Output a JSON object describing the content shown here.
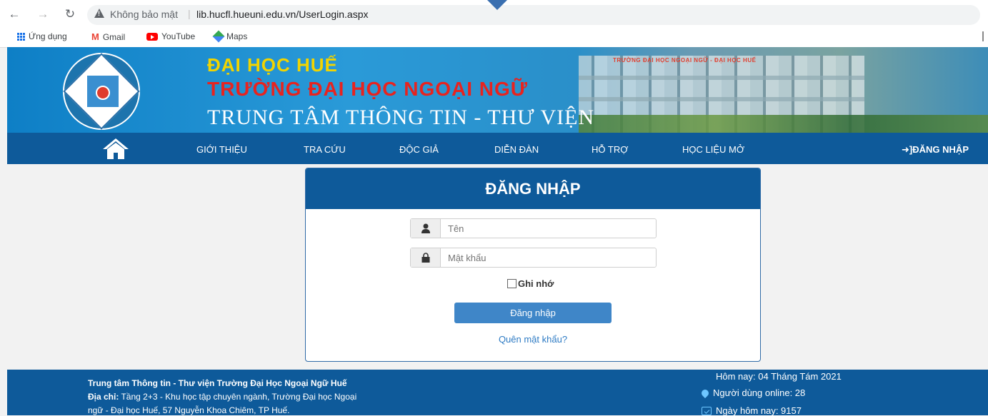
{
  "browser": {
    "security_label": "Không bảo mật",
    "separator": "|",
    "url": "lib.hucfl.hueuni.edu.vn/UserLogin.aspx",
    "bookmarks": [
      {
        "label": "Ứng dụng",
        "icon": "apps-icon"
      },
      {
        "label": "Gmail",
        "icon": "gmail-icon"
      },
      {
        "label": "YouTube",
        "icon": "youtube-icon"
      },
      {
        "label": "Maps",
        "icon": "maps-icon"
      }
    ]
  },
  "banner": {
    "line1": "ĐẠI HỌC HUẾ",
    "line2": "TRƯỜNG ĐẠI HỌC NGOẠI NGỮ",
    "line3": "TRUNG TÂM THÔNG TIN - THƯ VIỆN",
    "building_sign": "TRƯỜNG ĐẠI HỌC NGOẠI NGỮ - ĐẠI HỌC HUẾ",
    "colors": {
      "line1": "#f2d400",
      "line2": "#e8231f",
      "line3": "#ffffff"
    }
  },
  "nav": {
    "items": [
      "GIỚI THIỆU",
      "TRA CỨU",
      "ĐỘC GIẢ",
      "DIỄN ĐÀN",
      "HỖ TRỢ",
      "HỌC LIỆU MỞ"
    ],
    "login": "ĐĂNG NHẬP",
    "bg_color": "#0e5a9a"
  },
  "login": {
    "title": "ĐĂNG NHẬP",
    "username_placeholder": "Tên",
    "password_placeholder": "Mật khẩu",
    "remember_label": "Ghi nhớ",
    "submit_label": "Đăng nhập",
    "forgot_label": "Quên mật khẩu?"
  },
  "footer": {
    "title": "Trung tâm Thông tin - Thư viện Trường Đại Học Ngoại Ngữ Huế",
    "address_label": "Địa chỉ:",
    "address_line1": " Tầng 2+3 - Khu học tập chuyên ngành, Trường Đại học Ngoại",
    "address_line2": "ngữ - Đại học Huế, 57 Nguyễn Khoa Chiêm, TP Huế.",
    "date": "Hôm nay: 04 Tháng Tám 2021",
    "online": "Người dùng online: 28",
    "today_visits": "Ngày hôm nay: 9157"
  }
}
